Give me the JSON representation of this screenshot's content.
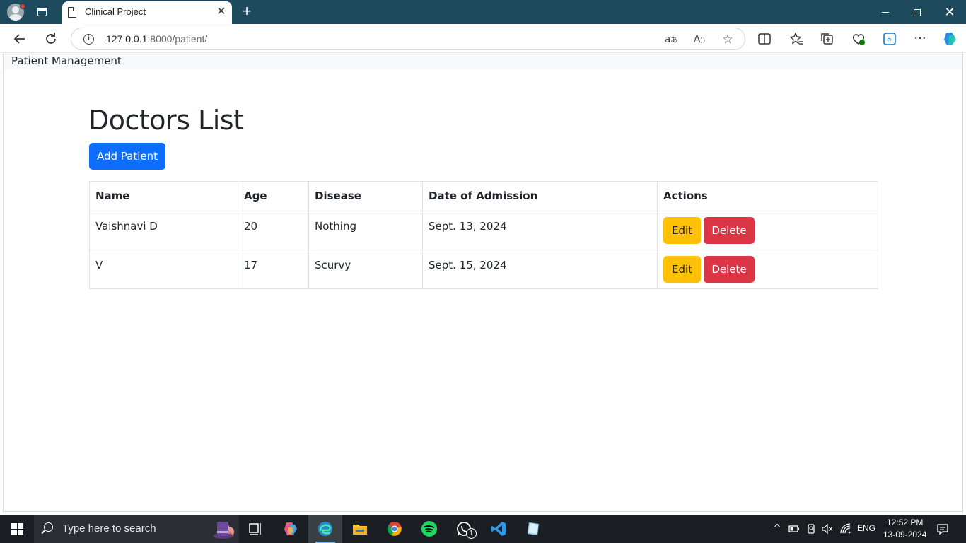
{
  "browser": {
    "tab_title": "Clinical Project",
    "url_host": "127.0.0.1",
    "url_path": ":8000/patient/"
  },
  "page": {
    "brand": "Patient Management",
    "title": "Doctors List",
    "add_button": "Add Patient",
    "table": {
      "headers": [
        "Name",
        "Age",
        "Disease",
        "Date of Admission",
        "Actions"
      ],
      "rows": [
        {
          "name": "Vaishnavi D",
          "age": "20",
          "disease": "Nothing",
          "date": "Sept. 13, 2024",
          "edit": "Edit",
          "delete": "Delete"
        },
        {
          "name": "V",
          "age": "17",
          "disease": "Scurvy",
          "date": "Sept. 15, 2024",
          "edit": "Edit",
          "delete": "Delete"
        }
      ]
    }
  },
  "taskbar": {
    "search_placeholder": "Type here to search",
    "language": "ENG",
    "time": "12:52 PM",
    "date": "13-09-2024",
    "whatsapp_badge": "1"
  },
  "colors": {
    "primary": "#0d6efd",
    "warning": "#ffc107",
    "danger": "#dc3545",
    "tabstrip": "#1d4a5c"
  }
}
